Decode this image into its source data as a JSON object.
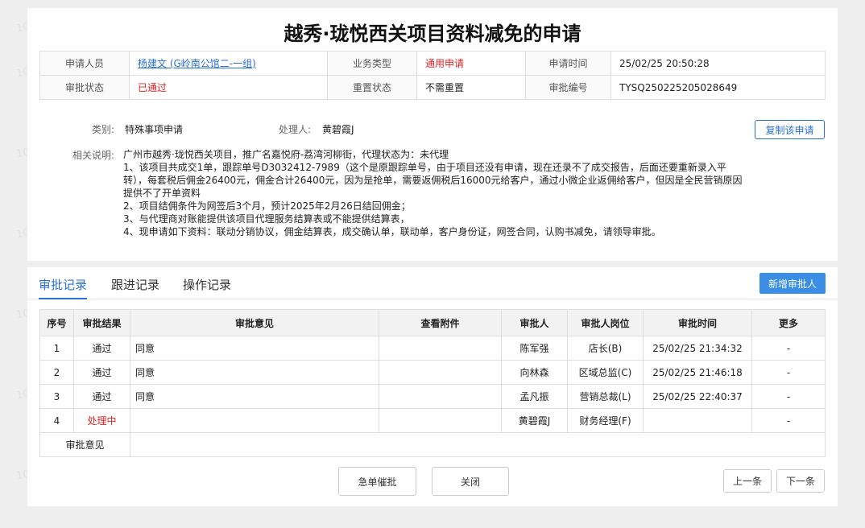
{
  "watermark": "1OcRXd",
  "header": {
    "title": "越秀·珑悦西关项目资料减免的申请"
  },
  "info": {
    "applicant_label": "申请人员",
    "applicant_value": "杨建文 (G岭南公馆二-一组)",
    "biz_type_label": "业务类型",
    "biz_type_value": "通用申请",
    "apply_time_label": "申请时间",
    "apply_time_value": "25/02/25 20:50:28",
    "status_label": "审批状态",
    "status_value": "已通过",
    "reset_label": "重置状态",
    "reset_value": "不需重置",
    "approval_no_label": "审批编号",
    "approval_no_value": "TYSQ250225205028649"
  },
  "meta": {
    "category_label": "类别:",
    "category_value": "特殊事项申请",
    "handler_label": "处理人:",
    "handler_value": "黄碧霞J",
    "copy_button": "复制该申请"
  },
  "description": {
    "label": "相关说明:",
    "lines": [
      "广州市越秀·珑悦西关项目，推广名嘉悦府-荔湾河柳街，代理状态为：未代理",
      "1、该项目共成交1单，跟踪单号D3032412-7989（这个是原跟踪单号，由于项目还没有申请，现在还录不了成交报告，后面还要重新录入平",
      "转），每套税后佣金26400元，佣金合计26400元，因为是抢单，需要返佣税后16000元给客户，通过小微企业返佣给客户，但因是全民营销原因",
      "提供不了开单资料",
      "2、项目结佣条件为网签后3个月，预计2025年2月26日结回佣金；",
      "3、与代理商对账能提供该项目代理服务结算表或不能提供结算表，",
      "4、现申请如下资料：联动分销协议，佣金结算表，成交确认单，联动单，客户身份证，网签合同，认购书减免，请领导审批。"
    ]
  },
  "tabs": {
    "approval": "审批记录",
    "followup": "跟进记录",
    "operation": "操作记录",
    "add_approver": "新增审批人"
  },
  "records": {
    "headers": [
      "序号",
      "审批结果",
      "审批意见",
      "查看附件",
      "审批人",
      "审批人岗位",
      "审批时间",
      "更多"
    ],
    "rows": [
      [
        "1",
        "通过",
        "同意",
        "",
        "陈军强",
        "店长(B)",
        "25/02/25 21:34:32",
        "-"
      ],
      [
        "2",
        "通过",
        "同意",
        "",
        "向林森",
        "区域总监(C)",
        "25/02/25 21:46:18",
        "-"
      ],
      [
        "3",
        "通过",
        "同意",
        "",
        "孟凡振",
        "营销总裁(L)",
        "25/02/25 22:40:37",
        "-"
      ],
      [
        "4",
        "处理中",
        "",
        "",
        "黄碧霞J",
        "财务经理(F)",
        "",
        "-"
      ]
    ],
    "opinion_label": "审批意见"
  },
  "footer": {
    "urge": "急单催批",
    "close": "关闭",
    "prev": "上一条",
    "next": "下一条"
  }
}
